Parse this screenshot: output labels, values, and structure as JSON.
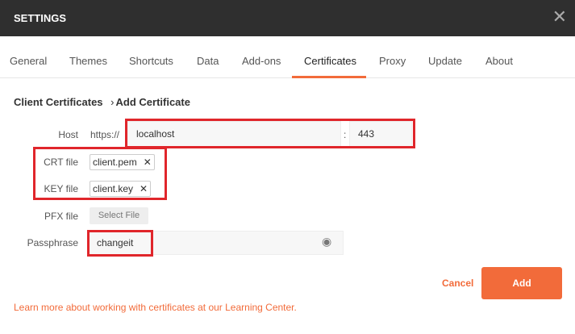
{
  "title": "SETTINGS",
  "tabs": [
    "General",
    "Themes",
    "Shortcuts",
    "Data",
    "Add-ons",
    "Certificates",
    "Proxy",
    "Update",
    "About"
  ],
  "breadcrumb": {
    "parent": "Client Certificates",
    "current": "Add Certificate"
  },
  "form": {
    "host_label": "Host",
    "host_prefix": "https://",
    "host": "localhost",
    "port": "443",
    "colon": ":",
    "crt_label": "CRT file",
    "crt_file": "client.pem",
    "key_label": "KEY file",
    "key_file": "client.key",
    "pfx_label": "PFX file",
    "select_file": "Select File",
    "pass_label": "Passphrase",
    "passphrase": "changeit"
  },
  "actions": {
    "cancel": "Cancel",
    "add": "Add"
  },
  "learn_more": "Learn more about working with certificates at our Learning Center."
}
